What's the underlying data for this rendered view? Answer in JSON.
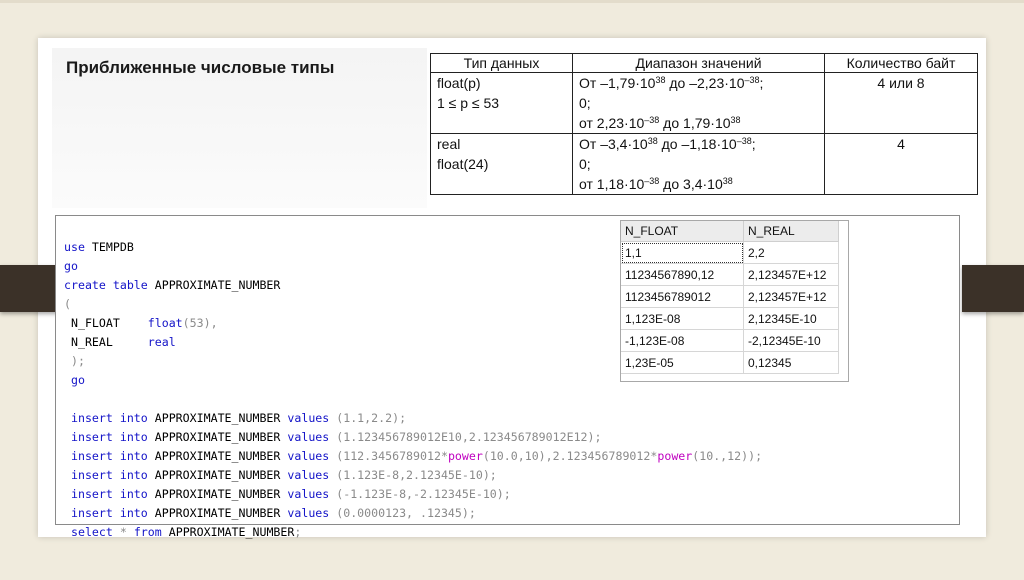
{
  "title": "Приближенные числовые типы",
  "types_table": {
    "headers": [
      "Тип данных",
      "Диапазон значений",
      "Количество байт"
    ],
    "rows": [
      {
        "type_lines": [
          "float(p)",
          "1 ≤ p ≤ 53"
        ],
        "range_lines": [
          [
            "От –1,79·10",
            "38",
            " до –2,23·10",
            "–38",
            ";"
          ],
          [
            "0;"
          ],
          [
            "от 2,23·10",
            "–38",
            " до 1,79·10",
            "38",
            ""
          ]
        ],
        "bytes": "4 или 8"
      },
      {
        "type_lines": [
          "real",
          "float(24)"
        ],
        "range_lines": [
          [
            "От –3,4·10",
            "38",
            " до –1,18·10",
            "–38",
            ";"
          ],
          [
            "0;"
          ],
          [
            "от 1,18·10",
            "–38",
            " до 3,4·10",
            "38",
            ""
          ]
        ],
        "bytes": "4"
      }
    ]
  },
  "code": {
    "l1": {
      "k": "use",
      "t": " TEMPDB"
    },
    "l2": {
      "k": "go"
    },
    "l3": {
      "k": "create table",
      "t": " APPROXIMATE_NUMBER"
    },
    "l4": {
      "g": "("
    },
    "l5": {
      "t": " N_FLOAT    ",
      "k": "float",
      "g": "(53),"
    },
    "l6": {
      "t": " N_REAL     ",
      "k": "real"
    },
    "l7": {
      "g": " );"
    },
    "l8": {
      "k": " go"
    },
    "i1": {
      "k1": " insert into",
      "t": " APPROXIMATE_NUMBER ",
      "k2": "values",
      "g": " (1.1,2.2);"
    },
    "i2": {
      "k1": " insert into",
      "t": " APPROXIMATE_NUMBER ",
      "k2": "values",
      "g": " (1.123456789012E10,2.123456789012E12);"
    },
    "i3": {
      "k1": " insert into",
      "t": " APPROXIMATE_NUMBER ",
      "k2": "values",
      "g1": " (112.3456789012*",
      "f1": "power",
      "g2": "(10.0,10),2.123456789012*",
      "f2": "power",
      "g3": "(10.,12));"
    },
    "i4": {
      "k1": " insert into",
      "t": " APPROXIMATE_NUMBER ",
      "k2": "values",
      "g": " (1.123E-8,2.12345E-10);"
    },
    "i5": {
      "k1": " insert into",
      "t": " APPROXIMATE_NUMBER ",
      "k2": "values",
      "g": " (-1.123E-8,-2.12345E-10);"
    },
    "i6": {
      "k1": " insert into",
      "t": " APPROXIMATE_NUMBER ",
      "k2": "values",
      "g": " (0.0000123, .12345);"
    },
    "s1": {
      "k1": " select",
      "g": " *",
      "k2": " from",
      "t": " APPROXIMATE_NUMBER",
      "g2": ";"
    }
  },
  "results": {
    "columns": [
      "N_FLOAT",
      "N_REAL"
    ],
    "rows": [
      [
        "1,1",
        "2,2"
      ],
      [
        "11234567890,12",
        "2,123457E+12"
      ],
      [
        "1123456789012",
        "2,123457E+12"
      ],
      [
        "1,123E-08",
        "2,12345E-10"
      ],
      [
        "-1,123E-08",
        "-2,12345E-10"
      ],
      [
        "1,23E-05",
        "0,12345"
      ]
    ]
  }
}
